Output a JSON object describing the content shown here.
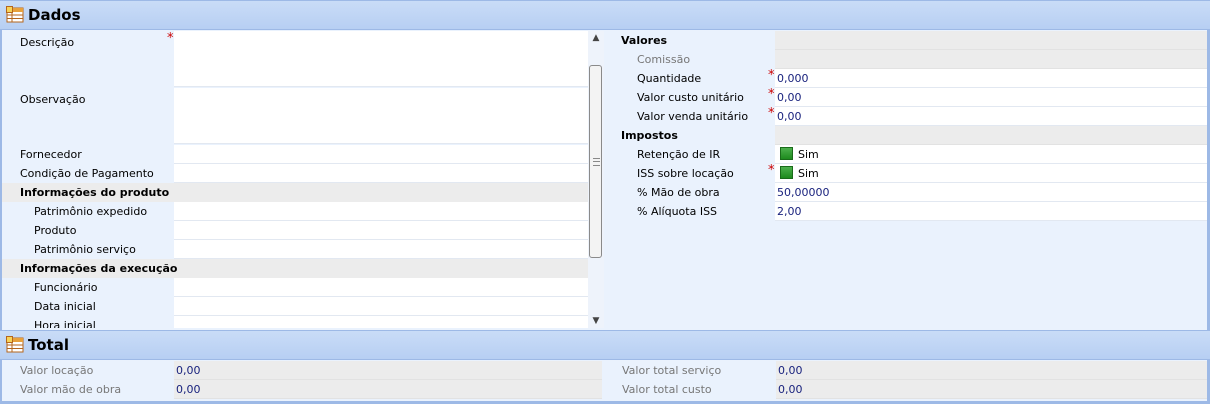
{
  "dados": {
    "title": "Dados",
    "icon": "table-icon",
    "left": {
      "descricao": {
        "label": "Descrição",
        "required": "*",
        "value": ""
      },
      "observacao": {
        "label": "Observação",
        "value": ""
      },
      "fornecedor": {
        "label": "Fornecedor",
        "value": ""
      },
      "condicao": {
        "label": "Condição de Pagamento",
        "value": ""
      },
      "grupo_produto": {
        "label": "Informações do produto"
      },
      "patrimonio_expedido": {
        "label": "Patrimônio expedido",
        "value": ""
      },
      "produto": {
        "label": "Produto",
        "value": ""
      },
      "patrimonio_servico": {
        "label": "Patrimônio serviço",
        "value": ""
      },
      "grupo_execucao": {
        "label": "Informações da execução"
      },
      "funcionario": {
        "label": "Funcionário",
        "value": ""
      },
      "data_inicial": {
        "label": "Data inicial",
        "value": ""
      },
      "hora_inicial": {
        "label": "Hora inicial",
        "value": ""
      }
    },
    "right": {
      "grupo_valores": {
        "label": "Valores"
      },
      "comissao": {
        "label": "Comissão",
        "value": ""
      },
      "quantidade": {
        "label": "Quantidade",
        "required": "*",
        "value": "0,000"
      },
      "valor_custo": {
        "label": "Valor custo unitário",
        "required": "*",
        "value": "0,00"
      },
      "valor_venda": {
        "label": "Valor venda unitário",
        "required": "*",
        "value": "0,00"
      },
      "grupo_impostos": {
        "label": "Impostos"
      },
      "retencao_ir": {
        "label": "Retenção de IR",
        "value": "Sim",
        "checked": true
      },
      "iss_locacao": {
        "label": "ISS sobre locação",
        "required": "*",
        "value": "Sim",
        "checked": true
      },
      "mao_obra": {
        "label": "% Mão de obra",
        "value": "50,00000"
      },
      "aliquota_iss": {
        "label": "% Alíquota ISS",
        "value": "2,00"
      }
    }
  },
  "total": {
    "title": "Total",
    "icon": "table-icon",
    "valor_locacao": {
      "label": "Valor locação",
      "value": "0,00"
    },
    "valor_mao_obra": {
      "label": "Valor mão de obra",
      "value": "0,00"
    },
    "valor_total_servico": {
      "label": "Valor total serviço",
      "value": "0,00"
    },
    "valor_total_custo": {
      "label": "Valor total custo",
      "value": "0,00"
    }
  },
  "colors": {
    "header_bg": "#c9dcf7",
    "panel_bg": "#eaf2fd",
    "value_text": "#1a237e",
    "required": "#cc0000",
    "checkbox_green": "#2e9b2e"
  }
}
